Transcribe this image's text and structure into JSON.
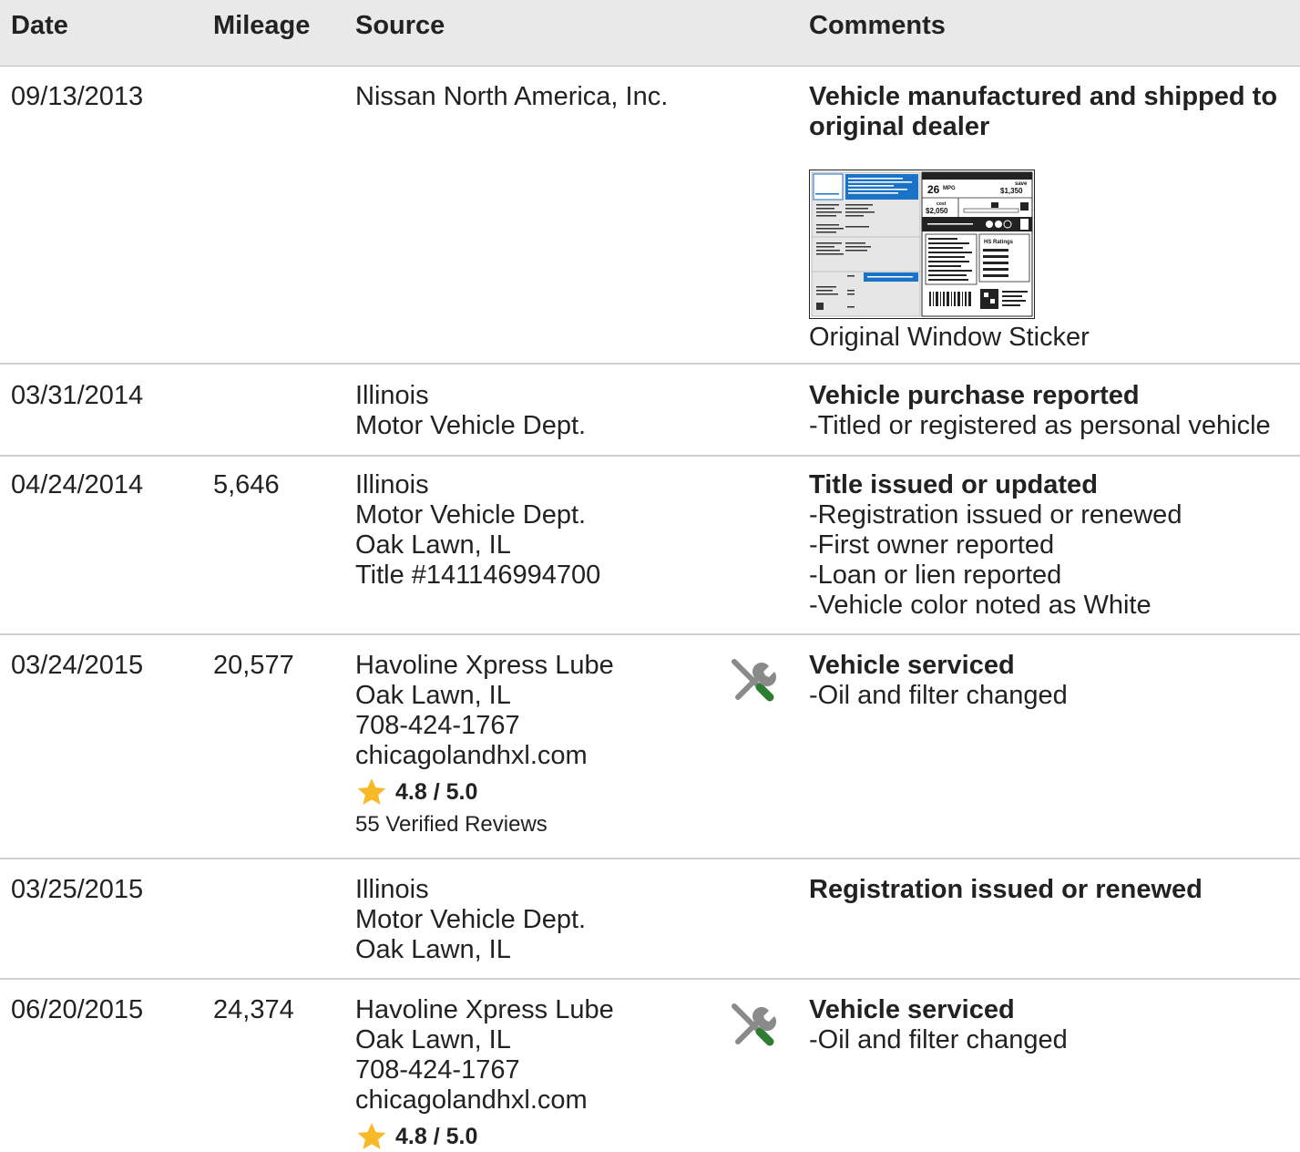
{
  "columns": {
    "date": "Date",
    "mileage": "Mileage",
    "source": "Source",
    "comments": "Comments"
  },
  "rows": [
    {
      "date": "09/13/2013",
      "mileage": "",
      "source": [
        "Nissan North America, Inc."
      ],
      "title": "Vehicle manufactured and shipped to original dealer",
      "bullets": [],
      "sticker": {
        "caption": "Original Window Sticker",
        "mpg": "26",
        "mpg_unit": "MPG",
        "save_label": "save",
        "save_amount": "$1,350",
        "fuel_cost_label": "cost",
        "fuel_cost": "$2,050",
        "ratings_label": "HS Ratings"
      }
    },
    {
      "date": "03/31/2014",
      "mileage": "",
      "source": [
        "Illinois",
        "Motor Vehicle Dept."
      ],
      "title": "Vehicle purchase reported",
      "bullets": [
        "Titled or registered as personal vehicle"
      ]
    },
    {
      "date": "04/24/2014",
      "mileage": "5,646",
      "source": [
        "Illinois",
        "Motor Vehicle Dept.",
        "Oak Lawn, IL",
        "Title #141146994700"
      ],
      "title": "Title issued or updated",
      "bullets": [
        "Registration issued or renewed",
        "First owner reported",
        "Loan or lien reported",
        "Vehicle color noted as White"
      ]
    },
    {
      "date": "03/24/2015",
      "mileage": "20,577",
      "source": [
        "Havoline Xpress Lube",
        "Oak Lawn, IL",
        "708-424-1767",
        "chicagolandhxl.com"
      ],
      "rating": "4.8 / 5.0",
      "reviews": "55 Verified Reviews",
      "icon": "service-tools-icon",
      "title": "Vehicle serviced",
      "bullets": [
        "Oil and filter changed"
      ]
    },
    {
      "date": "03/25/2015",
      "mileage": "",
      "source": [
        "Illinois",
        "Motor Vehicle Dept.",
        "Oak Lawn, IL"
      ],
      "title": "Registration issued or renewed",
      "bullets": []
    },
    {
      "date": "06/20/2015",
      "mileage": "24,374",
      "source": [
        "Havoline Xpress Lube",
        "Oak Lawn, IL",
        "708-424-1767",
        "chicagolandhxl.com"
      ],
      "rating": "4.8 / 5.0",
      "icon": "service-tools-icon",
      "title": "Vehicle serviced",
      "bullets": [
        "Oil and filter changed"
      ]
    }
  ],
  "colors": {
    "header_bg": "#e9e9e9",
    "divider": "#cfcfcf",
    "star": "#f7b928",
    "tool_gray": "#8a8a8a",
    "tool_green": "#2e7d32",
    "sticker_blue": "#1a73c7"
  }
}
